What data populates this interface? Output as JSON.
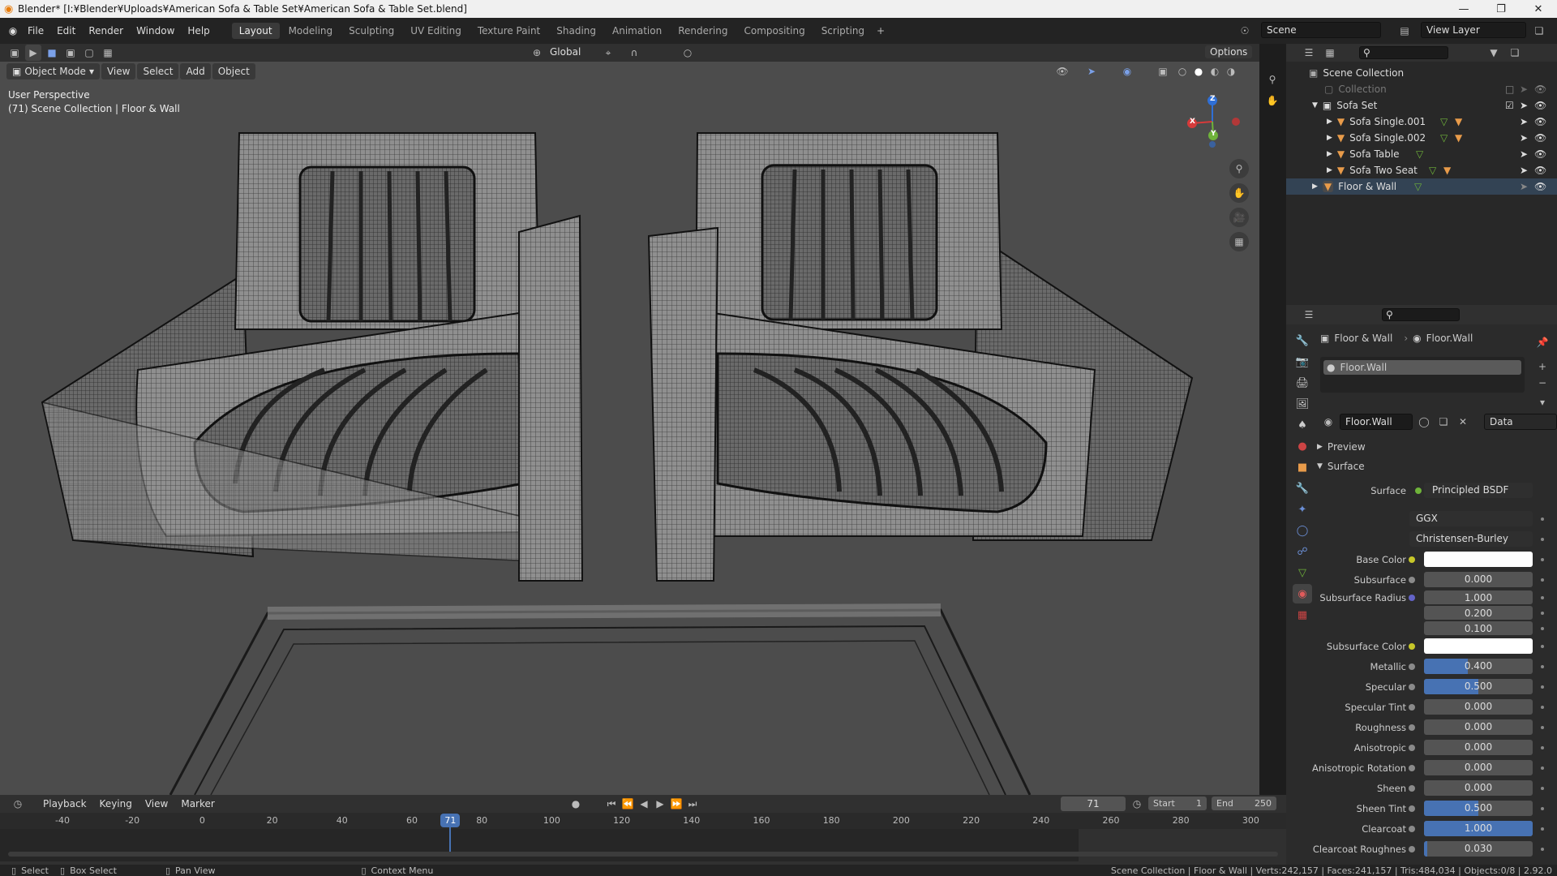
{
  "window": {
    "title": "Blender* [I:¥Blender¥Uploads¥American Sofa & Table Set¥American Sofa & Table Set.blend]",
    "controls": [
      "—",
      "❐",
      "✕"
    ]
  },
  "menu": [
    "File",
    "Edit",
    "Render",
    "Window",
    "Help"
  ],
  "workspaces": [
    "Layout",
    "Modeling",
    "Sculpting",
    "UV Editing",
    "Texture Paint",
    "Shading",
    "Animation",
    "Rendering",
    "Compositing",
    "Scripting"
  ],
  "active_workspace": "Layout",
  "scene": {
    "name": "Scene",
    "view_layer": "View Layer"
  },
  "viewport": {
    "mode": "Object Mode",
    "menus": [
      "View",
      "Select",
      "Add",
      "Object"
    ],
    "transform_orientation": "Global",
    "options": "Options",
    "info_line1": "User Perspective",
    "info_line2": "(71) Scene Collection | Floor & Wall",
    "gizmo": {
      "x": "X",
      "y": "Y",
      "z": "Z"
    }
  },
  "outliner": {
    "root": "Scene Collection",
    "items": [
      {
        "label": "Collection",
        "indent": 1,
        "dim": true
      },
      {
        "label": "Sofa Set",
        "indent": 1
      },
      {
        "label": "Sofa Single.001",
        "indent": 2
      },
      {
        "label": "Sofa Single.002",
        "indent": 2
      },
      {
        "label": "Sofa Table",
        "indent": 2
      },
      {
        "label": "Sofa Two Seat",
        "indent": 2
      },
      {
        "label": "Floor & Wall",
        "indent": 1
      }
    ]
  },
  "properties": {
    "breadcrumb_object": "Floor & Wall",
    "breadcrumb_material": "Floor.Wall",
    "slot": "Floor.Wall",
    "material_name": "Floor.Wall",
    "link": "Data",
    "panel_preview": "Preview",
    "panel_surface": "Surface",
    "surface_label": "Surface",
    "surface_shader": "Principled BSDF",
    "distribution": "GGX",
    "subsurface_method": "Christensen-Burley",
    "rows": [
      {
        "label": "Base Color",
        "value": "",
        "type": "color",
        "dot": "y"
      },
      {
        "label": "Subsurface",
        "value": "0.000",
        "dot": "g",
        "fill": 0
      },
      {
        "label": "Subsurface Radius",
        "value": "1.000",
        "dot": "b",
        "fill": 0
      },
      {
        "label": "",
        "value": "0.200",
        "dot": "",
        "fill": 0
      },
      {
        "label": "",
        "value": "0.100",
        "dot": "",
        "fill": 0
      },
      {
        "label": "Subsurface Color",
        "value": "",
        "type": "color",
        "dot": "y"
      },
      {
        "label": "Metallic",
        "value": "0.400",
        "dot": "g",
        "fill": 0.4
      },
      {
        "label": "Specular",
        "value": "0.500",
        "dot": "g",
        "fill": 0.5
      },
      {
        "label": "Specular Tint",
        "value": "0.000",
        "dot": "g",
        "fill": 0
      },
      {
        "label": "Roughness",
        "value": "0.000",
        "dot": "g",
        "fill": 0
      },
      {
        "label": "Anisotropic",
        "value": "0.000",
        "dot": "g",
        "fill": 0
      },
      {
        "label": "Anisotropic Rotation",
        "value": "0.000",
        "dot": "g",
        "fill": 0
      },
      {
        "label": "Sheen",
        "value": "0.000",
        "dot": "g",
        "fill": 0
      },
      {
        "label": "Sheen Tint",
        "value": "0.500",
        "dot": "g",
        "fill": 0.5
      },
      {
        "label": "Clearcoat",
        "value": "1.000",
        "dot": "g",
        "fill": 1
      },
      {
        "label": "Clearcoat Roughnes",
        "value": "0.030",
        "dot": "g",
        "fill": 0.03
      }
    ]
  },
  "timeline": {
    "menus": [
      "Playback",
      "Keying",
      "View",
      "Marker"
    ],
    "current_frame": "71",
    "start_label": "Start",
    "start": "1",
    "end_label": "End",
    "end": "250",
    "ticks": [
      "-40",
      "-20",
      "0",
      "20",
      "40",
      "60",
      "80",
      "100",
      "120",
      "140",
      "160",
      "180",
      "200",
      "220",
      "240",
      "260",
      "280",
      "300"
    ]
  },
  "statusbar": {
    "select": "Select",
    "box_select": "Box Select",
    "pan_view": "Pan View",
    "context_menu": "Context Menu",
    "stats": "Scene Collection | Floor & Wall | Verts:242,157 | Faces:241,157 | Tris:484,034 | Objects:0/8 | 2.92.0"
  },
  "colors": {
    "accent": "#4772b3",
    "viewport_bg": "#4c4c4c",
    "frame_marker": "#4772b3"
  }
}
